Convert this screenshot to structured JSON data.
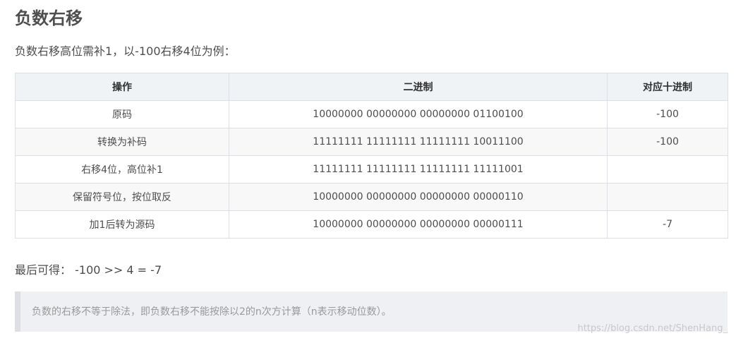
{
  "article": {
    "title": "负数右移",
    "intro": "负数右移高位需补1，以-100右移4位为例：",
    "table": {
      "headers": [
        "操作",
        "二进制",
        "对应十进制"
      ],
      "rows": [
        [
          "原码",
          "10000000 00000000 00000000 01100100",
          "-100"
        ],
        [
          "转换为补码",
          "11111111 11111111 11111111 10011100",
          "-100"
        ],
        [
          "右移4位，高位补1",
          "11111111 11111111 11111111 11111001",
          ""
        ],
        [
          "保留符号位，按位取反",
          "10000000 00000000 00000000 00000110",
          ""
        ],
        [
          "加1后转为源码",
          "10000000 00000000 00000000 00000111",
          "-7"
        ]
      ]
    },
    "result_label": "最后可得：",
    "result_expr": "-100 >> 4 = -7",
    "note": "负数的右移不等于除法，即负数右移不能按除以2的n次方计算（n表示移动位数）。",
    "watermark": "https://blog.csdn.net/ShenHang_"
  }
}
